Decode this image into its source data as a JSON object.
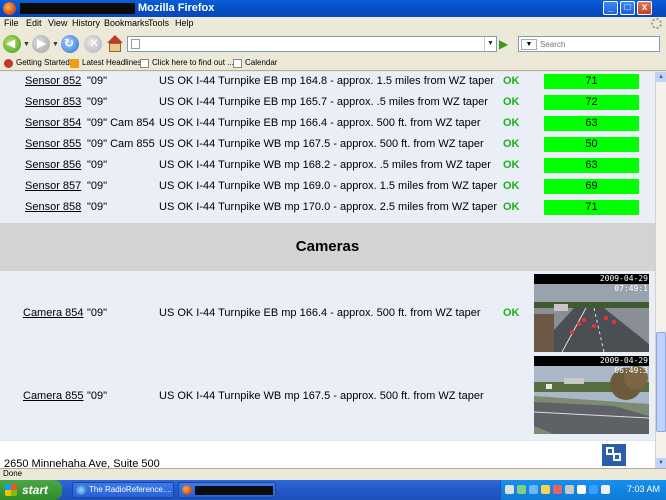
{
  "window": {
    "title": "Mozilla Firefox",
    "controls": [
      "_",
      "□",
      "x"
    ]
  },
  "menu": [
    "File",
    "Edit",
    "View",
    "History",
    "Bookmarks",
    "Tools",
    "Help"
  ],
  "navbar": {
    "url": "",
    "search_placeholder": "Search",
    "icons": [
      "back-icon",
      "forward-icon",
      "reload-icon",
      "stop-icon",
      "home-icon",
      "go-icon"
    ]
  },
  "bookmarks": [
    "Getting Started",
    "Latest Headlines",
    "Click here to find out ...",
    "Calendar"
  ],
  "sensors": [
    {
      "name": "Sensor 852",
      "code": "\"09\"",
      "desc": "US OK I-44 Turnpike EB mp 164.8 - approx. 1.5 miles from WZ taper",
      "status": "OK",
      "value": "71"
    },
    {
      "name": "Sensor 853",
      "code": "\"09\"",
      "desc": "US OK I-44 Turnpike EB mp 165.7 - approx. .5 miles from WZ taper",
      "status": "OK",
      "value": "72"
    },
    {
      "name": "Sensor 854",
      "code": "\"09\" Cam 854",
      "desc": "US OK I-44 Turnpike EB mp 166.4 - approx. 500 ft. from WZ taper",
      "status": "OK",
      "value": "63"
    },
    {
      "name": "Sensor 855",
      "code": "\"09\" Cam 855",
      "desc": "US OK I-44 Turnpike WB mp 167.5 - approx. 500 ft. from WZ taper",
      "status": "OK",
      "value": "50"
    },
    {
      "name": "Sensor 856",
      "code": "\"09\"",
      "desc": "US OK I-44 Turnpike WB mp 168.2 - approx. .5 miles from WZ taper",
      "status": "OK",
      "value": "63"
    },
    {
      "name": "Sensor 857",
      "code": "\"09\"",
      "desc": "US OK I-44 Turnpike WB mp 169.0 - approx. 1.5 miles from WZ taper",
      "status": "OK",
      "value": "69"
    },
    {
      "name": "Sensor 858",
      "code": "\"09\"",
      "desc": "US OK I-44 Turnpike WB mp 170.0 - approx. 2.5 miles from WZ taper",
      "status": "OK",
      "value": "71"
    }
  ],
  "cameras_heading": "Cameras",
  "cameras": [
    {
      "name": "Camera 854",
      "code": "\"09\"",
      "desc": "US OK I-44 Turnpike EB mp 166.4 - approx. 500 ft. from WZ taper",
      "status": "OK",
      "timestamp": "2009-04-29 07:49:1"
    },
    {
      "name": "Camera 855",
      "code": "\"09\"",
      "desc": "US OK I-44 Turnpike WB mp 167.5 - approx. 500 ft. from WZ taper",
      "status": "",
      "timestamp": "2009-04-29 06:49:3"
    }
  ],
  "footer": {
    "address": "2650 Minnehaha Ave, Suite 500"
  },
  "status": {
    "text": "Done"
  },
  "taskbar": {
    "start": "start",
    "tasks": [
      "The RadioReference....",
      ""
    ],
    "clock": "7:03 AM"
  },
  "colors": {
    "value_bar": "#00ff00",
    "ok_text": "#1ab31a",
    "link": "#1a1aa6",
    "page_bg": "#eaeef7",
    "header_bg": "#d3d3d3"
  }
}
